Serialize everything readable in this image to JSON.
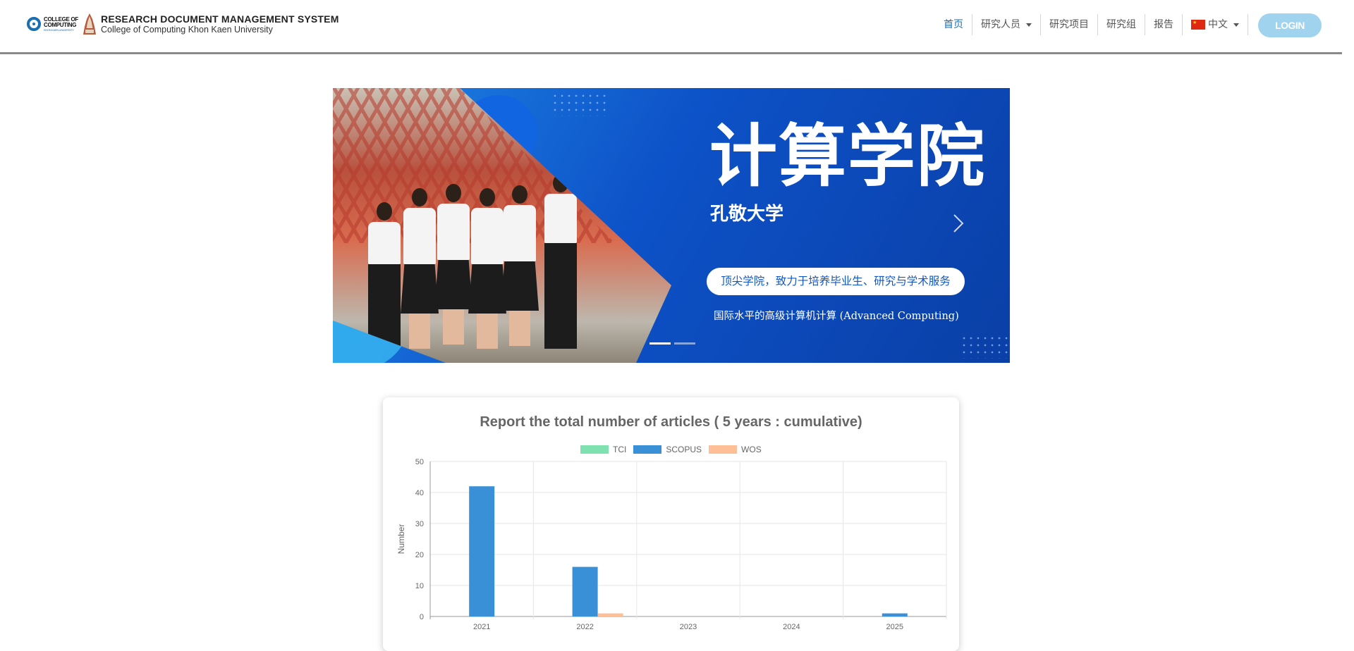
{
  "header": {
    "logo_text_line1": "COLLEGE OF",
    "logo_text_line2": "COMPUTING",
    "logo_text_small": "KHON KAEN UNIVERSITY",
    "system_title": "RESEARCH DOCUMENT MANAGEMENT SYSTEM",
    "system_subtitle": "College of Computing Khon Kaen University"
  },
  "nav": {
    "items": [
      {
        "label": "首页",
        "active": true,
        "dropdown": false
      },
      {
        "label": "研究人员",
        "active": false,
        "dropdown": true
      },
      {
        "label": "研究项目",
        "active": false,
        "dropdown": false
      },
      {
        "label": "研究组",
        "active": false,
        "dropdown": false
      },
      {
        "label": "报告",
        "active": false,
        "dropdown": false
      }
    ],
    "language_label": "中文",
    "language_flag_icon": "china-flag-icon",
    "login_label": "LOGIN",
    "active_color": "#1a6fb0",
    "login_color": "#9fd3ee"
  },
  "carousel": {
    "title": "计算学院",
    "subtitle": "孔敬大学",
    "pill_text": "顶尖学院，致力于培养毕业生、研究与学术服务",
    "tagline": "国际水平的高级计算机计算 (Advanced Computing)",
    "slides": 2,
    "active_slide": 1,
    "next_icon": "chevron-right-icon"
  },
  "chart_data": {
    "type": "bar",
    "title": "Report the total number of articles ( 5 years : cumulative)",
    "xlabel": "",
    "ylabel": "Number",
    "categories": [
      "2021",
      "2022",
      "2023",
      "2024",
      "2025"
    ],
    "series": [
      {
        "name": "TCI",
        "color": "#7fe0b0",
        "values": [
          0,
          0,
          0,
          0,
          0
        ]
      },
      {
        "name": "SCOPUS",
        "color": "#3a90d6",
        "values": [
          42,
          16,
          0,
          0,
          1
        ]
      },
      {
        "name": "WOS",
        "color": "#ffbf96",
        "values": [
          0,
          1,
          0,
          0,
          0
        ]
      }
    ],
    "ylim": [
      0,
      50
    ],
    "yticks": [
      0,
      10,
      20,
      30,
      40,
      50
    ],
    "grid": true,
    "legend_position": "top"
  }
}
